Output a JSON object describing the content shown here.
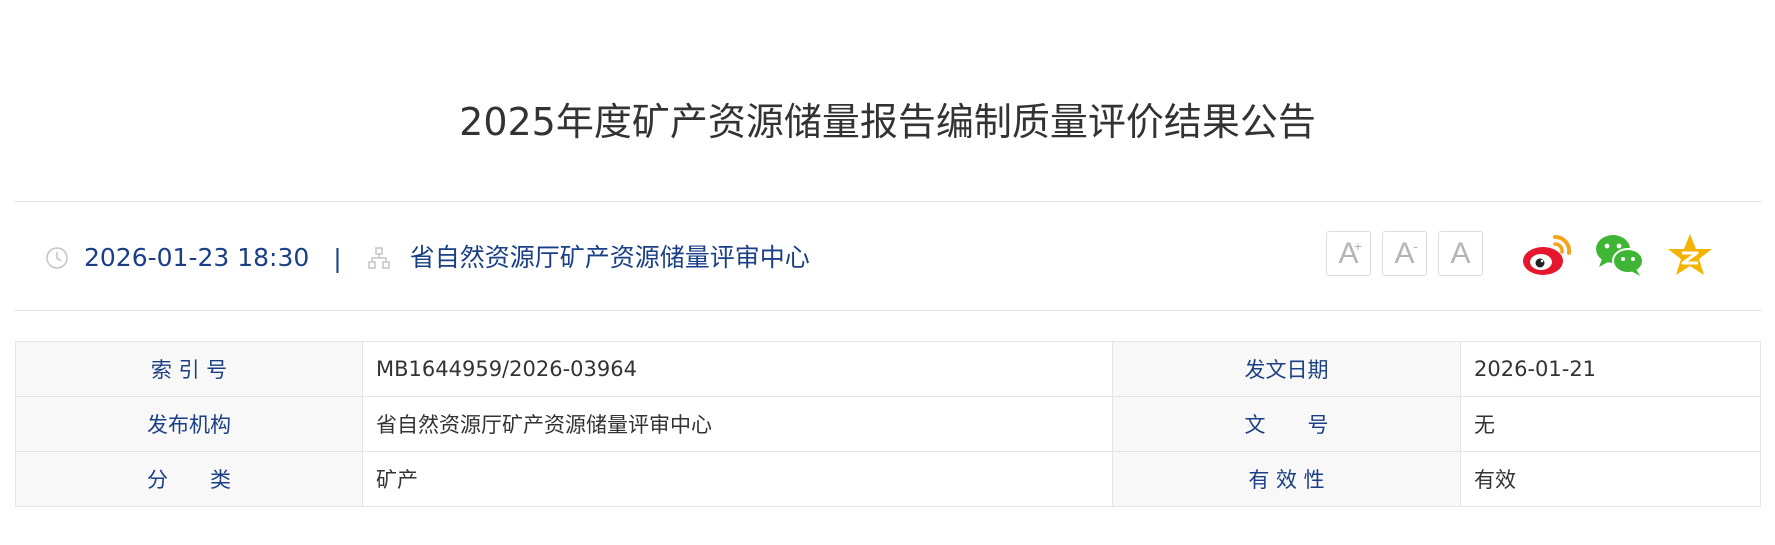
{
  "article": {
    "title": "2025年度矿产资源储量报告编制质量评价结果公告",
    "date": "2026-01-23 18:30",
    "separator": "|",
    "source": "省自然资源厅矿产资源储量评审中心"
  },
  "font_size_buttons": [
    {
      "label": "A",
      "modifier": "+"
    },
    {
      "label": "A",
      "modifier": "-"
    },
    {
      "label": "A",
      "modifier": ""
    }
  ],
  "share": [
    {
      "icon": "weibo-icon",
      "color": "#e6162d"
    },
    {
      "icon": "wechat-icon",
      "color": "#3fb535"
    },
    {
      "icon": "qzone-icon",
      "color": "#f5b300"
    }
  ],
  "info_table": {
    "rows": [
      {
        "label1": "索 引 号",
        "value1": "MB1644959/2026-03964",
        "label2": "发文日期",
        "value2": "2026-01-21"
      },
      {
        "label1": "发布机构",
        "value1": "省自然资源厅矿产资源储量评审中心",
        "label2": "文　　号",
        "value2": "无"
      },
      {
        "label1": "分　　类",
        "value1": "矿产",
        "label2": "有 效 性",
        "value2": "有效"
      }
    ]
  },
  "colors": {
    "accent": "#1a3f86",
    "border": "#e4e4e4",
    "label_bg": "#f8f8f8"
  }
}
